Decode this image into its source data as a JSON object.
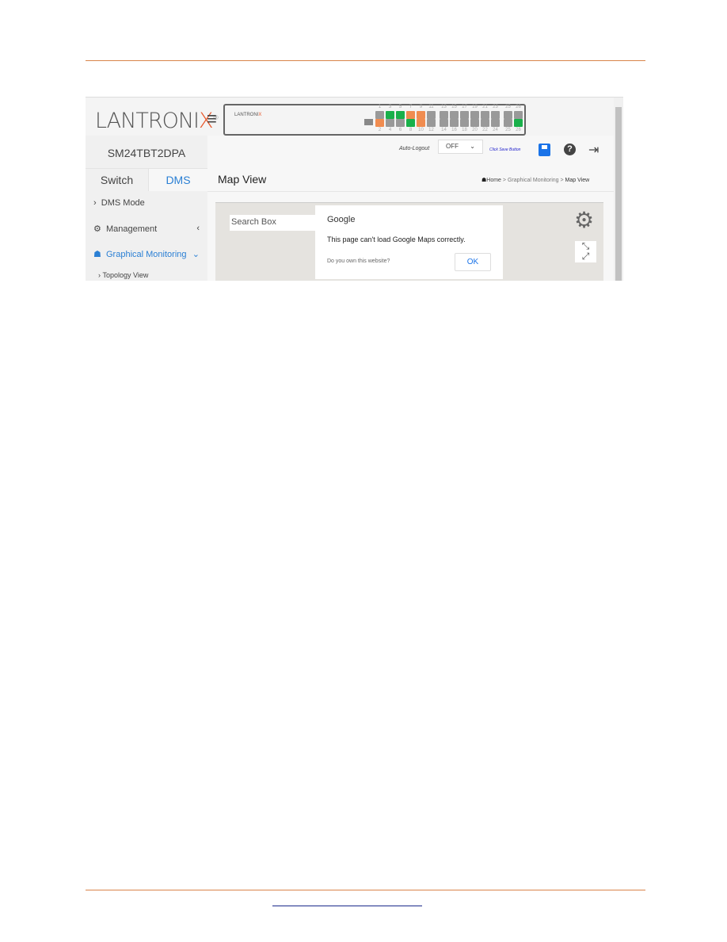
{
  "colors": {
    "rule": "#d9844a",
    "accent": "#2a7fd4",
    "brand_orange": "#e8572a",
    "port_green": "#19b04a",
    "port_orange": "#f08c50",
    "port_gray": "#999999"
  },
  "header": {
    "logo": "LANTRONIX",
    "menu_icon": "hamburger-icon",
    "panel_logo": "LANTRONIX"
  },
  "ports": {
    "top": [
      {
        "n": "1",
        "s": "gray"
      },
      {
        "n": "3",
        "s": "green"
      },
      {
        "n": "5",
        "s": "green"
      },
      {
        "n": "7",
        "s": "orange"
      },
      {
        "n": "9",
        "s": "orange"
      },
      {
        "n": "11",
        "s": "gray"
      },
      {
        "n": "13",
        "s": "gray"
      },
      {
        "n": "15",
        "s": "gray"
      },
      {
        "n": "17",
        "s": "gray"
      },
      {
        "n": "19",
        "s": "gray"
      },
      {
        "n": "21",
        "s": "gray"
      },
      {
        "n": "23",
        "s": "gray"
      },
      {
        "n": "25",
        "s": "gray"
      },
      {
        "n": "26",
        "s": "gray"
      }
    ],
    "bottom": [
      {
        "n": "2",
        "s": "orange"
      },
      {
        "n": "4",
        "s": "gray"
      },
      {
        "n": "6",
        "s": "gray"
      },
      {
        "n": "8",
        "s": "green"
      },
      {
        "n": "10",
        "s": "orange"
      },
      {
        "n": "12",
        "s": "gray"
      },
      {
        "n": "14",
        "s": "gray"
      },
      {
        "n": "16",
        "s": "gray"
      },
      {
        "n": "18",
        "s": "gray"
      },
      {
        "n": "20",
        "s": "gray"
      },
      {
        "n": "22",
        "s": "gray"
      },
      {
        "n": "24",
        "s": "gray"
      },
      {
        "n": "25",
        "s": "gray"
      },
      {
        "n": "26",
        "s": "green"
      }
    ]
  },
  "sidebar": {
    "model": "SM24TBT2DPA",
    "tabs": [
      "Switch",
      "DMS"
    ],
    "items": [
      {
        "label": "DMS Mode"
      },
      {
        "label": "Management"
      },
      {
        "label": "Graphical Monitoring"
      },
      {
        "label": "Topology View"
      }
    ]
  },
  "topbar": {
    "auto_logout_label": "Auto-Logout",
    "auto_logout_value": "OFF",
    "save_hint": "Click Save Button"
  },
  "page": {
    "title": "Map View",
    "breadcrumb": [
      "Home",
      "Graphical Monitoring",
      "Map View"
    ]
  },
  "map": {
    "search_placeholder": "Search Box",
    "dialog_title": "Google",
    "dialog_message": "This page can't load Google Maps correctly.",
    "dialog_link": "Do you own this website?",
    "ok_label": "OK"
  }
}
